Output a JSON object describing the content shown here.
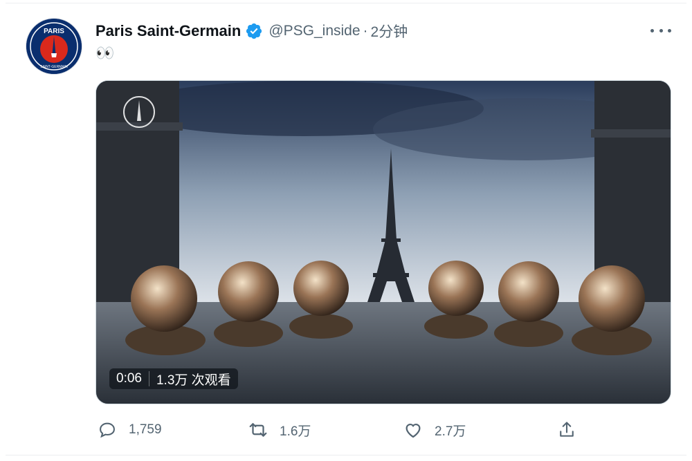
{
  "tweet": {
    "author_name": "Paris Saint-Germain",
    "handle": "@PSG_inside",
    "separator": "·",
    "time": "2分钟",
    "text": "👀",
    "avatar_logo": "PSG club crest (Paris)",
    "media": {
      "duration": "0:06",
      "views": "1.3万 次观看",
      "watermark_logo": "PSG crest watermark"
    },
    "actions": {
      "replies": "1,759",
      "retweets": "1.6万",
      "likes": "2.7万"
    }
  },
  "icons": {
    "verified": "verified-badge-icon",
    "more": "more-options-icon",
    "reply": "reply-icon",
    "retweet": "retweet-icon",
    "like": "like-icon",
    "share": "share-icon"
  },
  "colors": {
    "verified_blue": "#1d9bf0",
    "secondary_text": "#536471",
    "psg_navy": "#0a2e6e",
    "psg_red": "#da291c"
  }
}
